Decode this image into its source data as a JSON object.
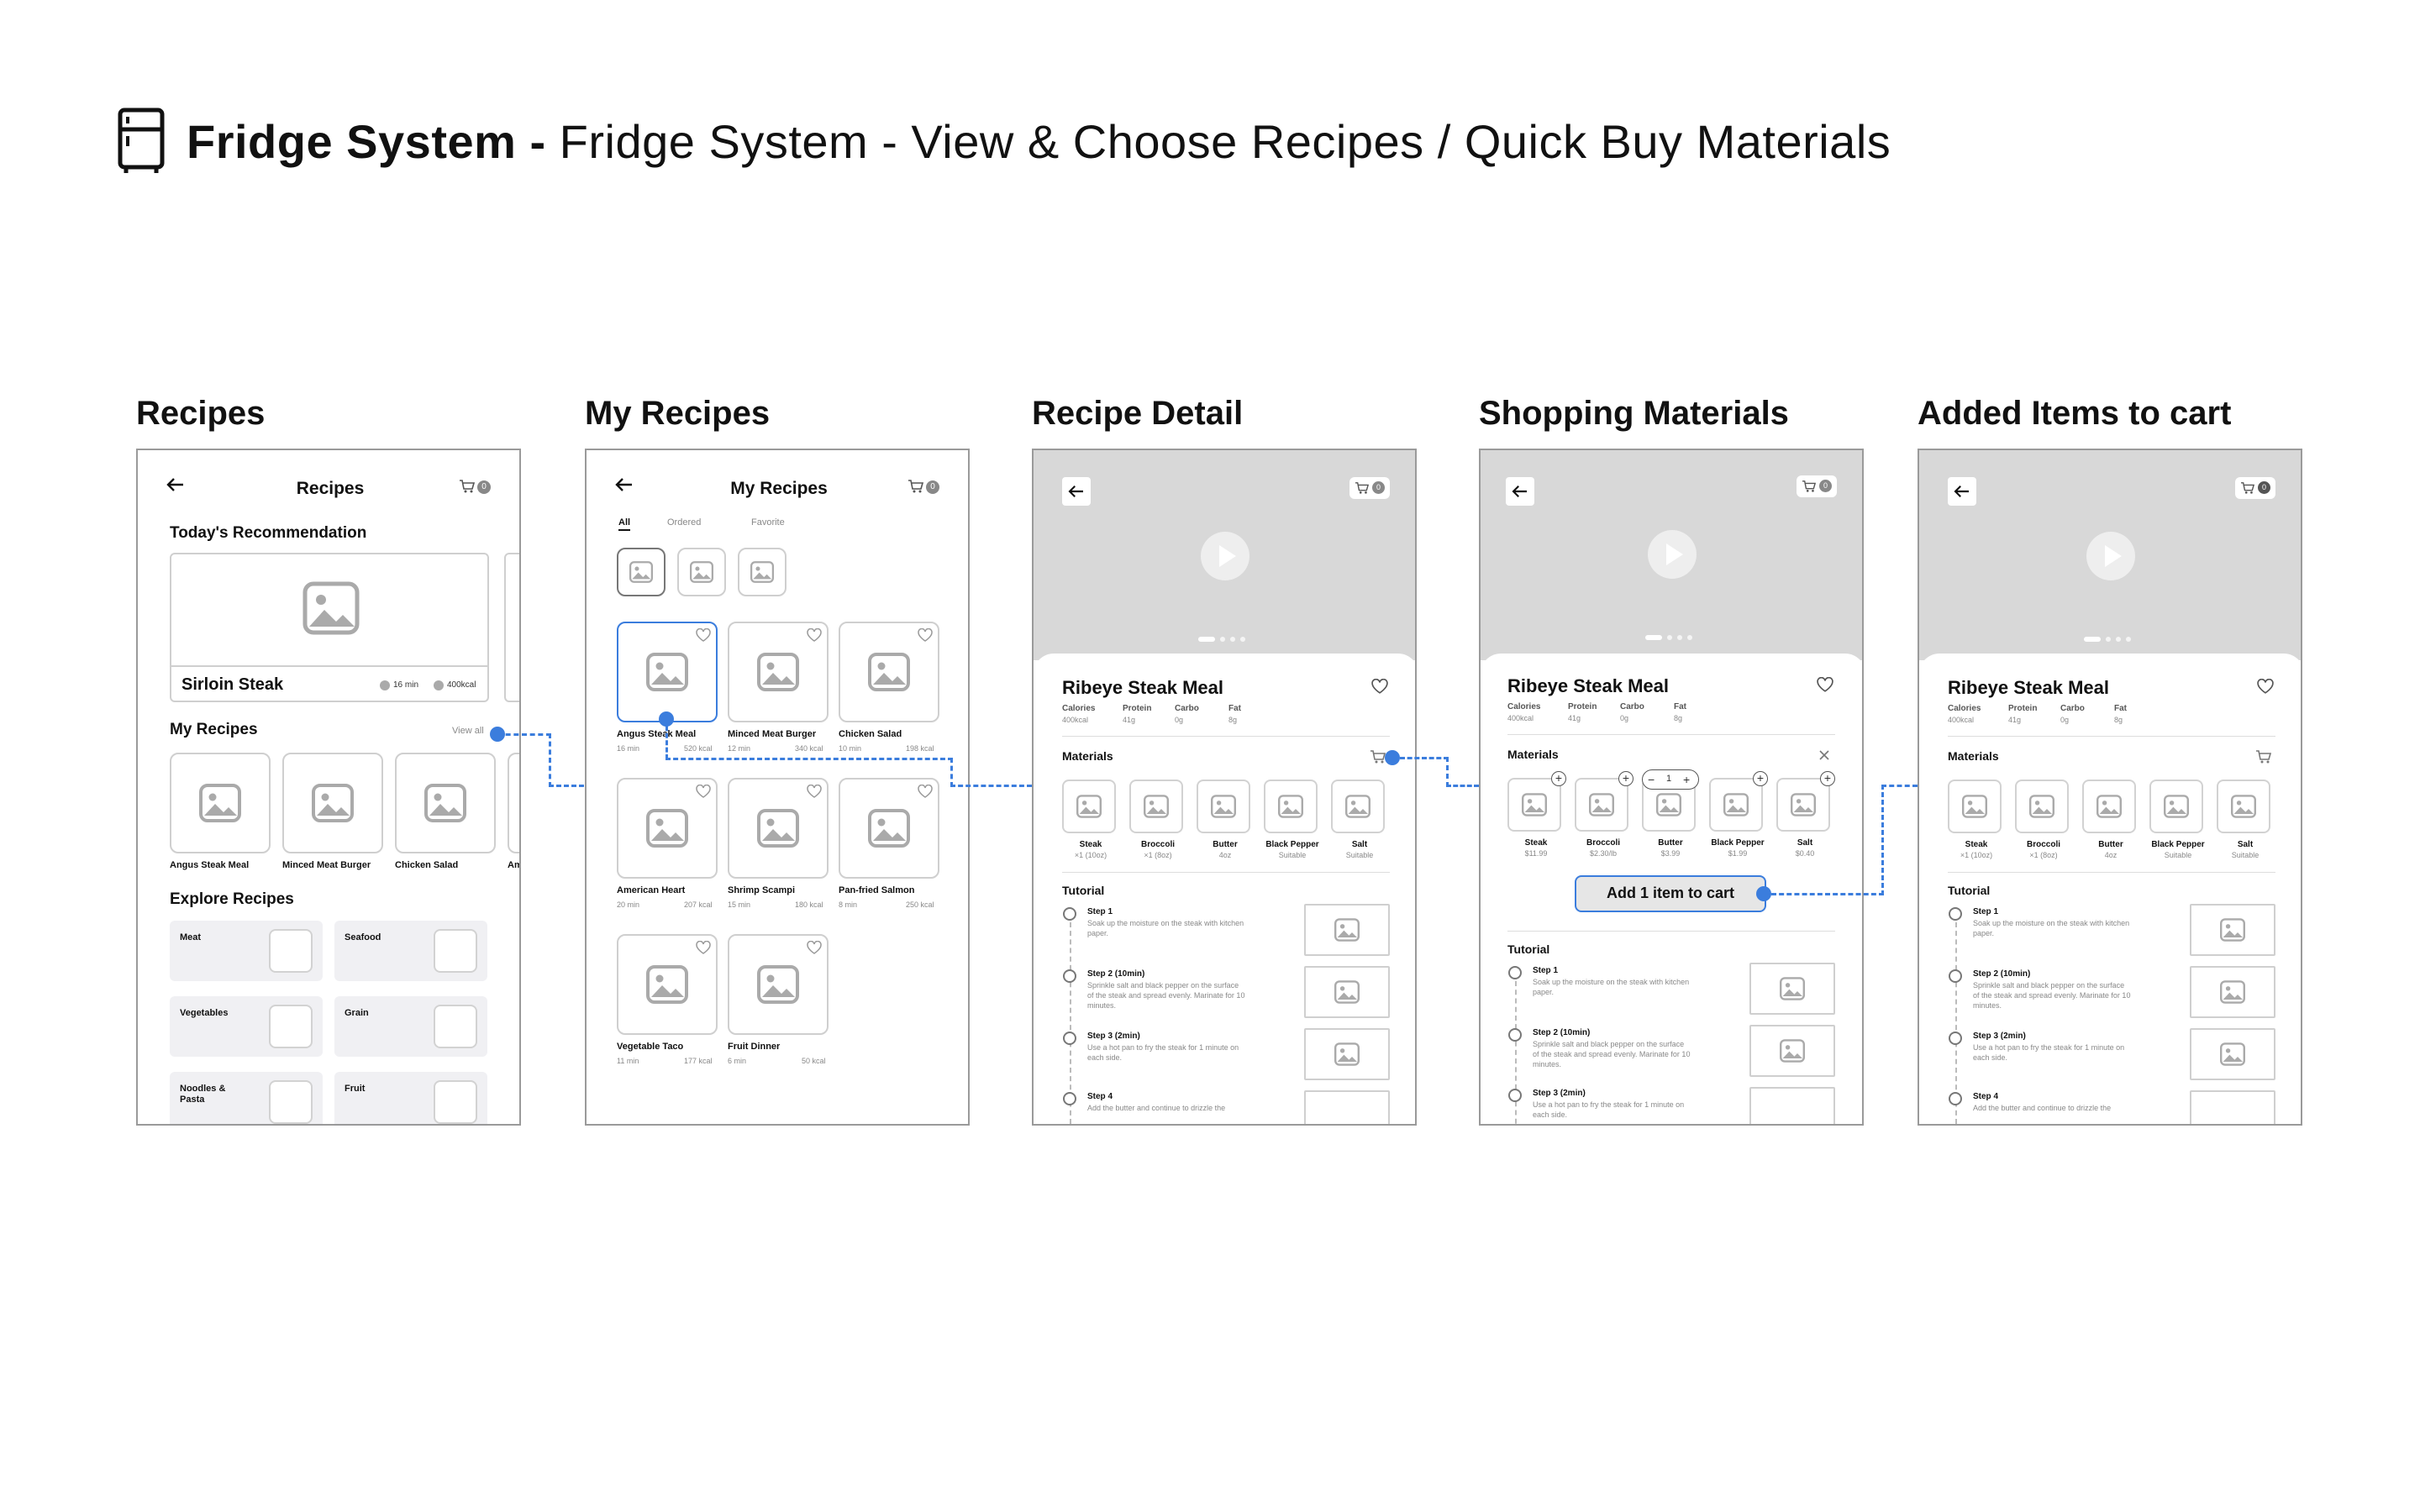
{
  "header": {
    "bold": "Fridge System - ",
    "rest": "Fridge System - View & Choose Recipes / Quick Buy Materials"
  },
  "frames": {
    "recipes": {
      "label": "Recipes",
      "title": "Recipes",
      "cart_count": "0",
      "todays": "Today's Recommendation",
      "featured": "Sirloin Steak",
      "featured_time": "16 min",
      "featured_kcal": "400kcal",
      "my_recipes": "My Recipes",
      "view_all": "View all",
      "items": [
        "Angus Steak Meal",
        "Minced Meat Burger",
        "Chicken Salad",
        "Am"
      ],
      "explore": "Explore Recipes",
      "categories": [
        "Meat",
        "Seafood",
        "Vegetables",
        "Grain",
        "Noodles & Pasta",
        "Fruit"
      ]
    },
    "my_recipes": {
      "label": "My Recipes",
      "title": "My Recipes",
      "cart_count": "0",
      "tabs": [
        "All",
        "Ordered",
        "Favorite"
      ],
      "items": [
        {
          "name": "Angus Steak Meal",
          "time": "16 min",
          "kcal": "520 kcal"
        },
        {
          "name": "Minced Meat Burger",
          "time": "12 min",
          "kcal": "340 kcal"
        },
        {
          "name": "Chicken Salad",
          "time": "10 min",
          "kcal": "198 kcal"
        },
        {
          "name": "American Heart",
          "time": "20 min",
          "kcal": "207 kcal"
        },
        {
          "name": "Shrimp Scampi",
          "time": "15 min",
          "kcal": "180 kcal"
        },
        {
          "name": "Pan-fried Salmon",
          "time": "8 min",
          "kcal": "250 kcal"
        },
        {
          "name": "Vegetable Taco",
          "time": "11 min",
          "kcal": "177 kcal"
        },
        {
          "name": "Fruit Dinner",
          "time": "6 min",
          "kcal": "50 kcal"
        }
      ]
    },
    "detail": {
      "label": "Recipe Detail",
      "cart_count": "0",
      "name": "Ribeye Steak Meal",
      "nutrition": [
        {
          "k": "Calories",
          "v": "400kcal"
        },
        {
          "k": "Protein",
          "v": "41g"
        },
        {
          "k": "Carbo",
          "v": "0g"
        },
        {
          "k": "Fat",
          "v": "8g"
        }
      ],
      "materials_label": "Materials",
      "materials": [
        {
          "n": "Steak",
          "q": "×1 (10oz)"
        },
        {
          "n": "Broccoli",
          "q": "×1 (8oz)"
        },
        {
          "n": "Butter",
          "q": "4oz"
        },
        {
          "n": "Black Pepper",
          "q": "Suitable"
        },
        {
          "n": "Salt",
          "q": "Suitable"
        }
      ],
      "tutorial": "Tutorial",
      "steps": [
        {
          "t": "Step 1",
          "d1": "Soak up the moisture on the steak with kitchen",
          "d2": "paper.",
          "d3": ""
        },
        {
          "t": "Step 2 (10min)",
          "d1": "Sprinkle salt and black pepper on the surface",
          "d2": "of the steak and spread evenly. Marinate for 10",
          "d3": "minutes."
        },
        {
          "t": "Step 3 (2min)",
          "d1": "Use a hot pan to fry the steak for 1 minute on",
          "d2": "each side.",
          "d3": ""
        },
        {
          "t": "Step 4",
          "d1": "Add the butter and continue to drizzle the",
          "d2": "",
          "d3": ""
        }
      ]
    },
    "shopping": {
      "label": "Shopping Materials",
      "cart_count": "0",
      "qty": "1",
      "prices": [
        "$11.99",
        "$2.30/lb",
        "$3.99",
        "$1.99",
        "$0.40"
      ],
      "add_button": "Add 1 item to cart"
    },
    "added": {
      "label": "Added Items to cart",
      "cart_count": "0"
    }
  }
}
